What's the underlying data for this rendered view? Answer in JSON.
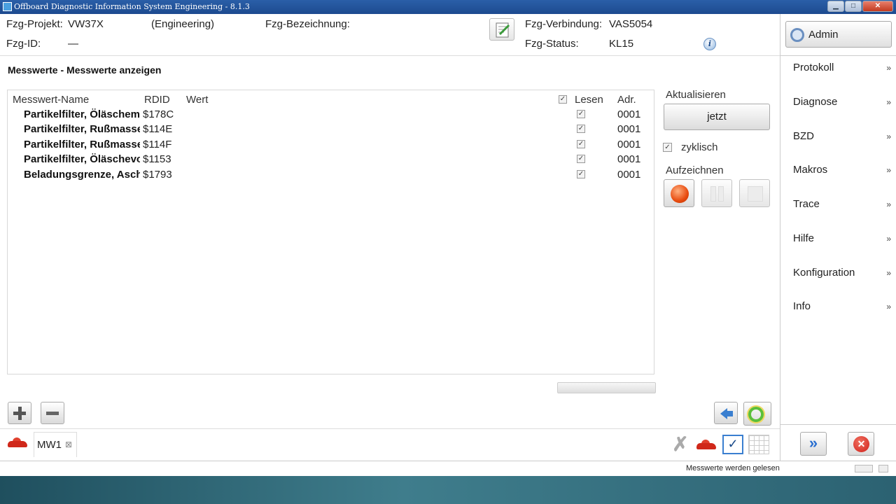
{
  "window": {
    "title": "Offboard Diagnostic Information System Engineering - 8.1.3",
    "minimize": "▁",
    "maximize": "□",
    "close": "✕"
  },
  "header": {
    "projekt_label": "Fzg-Projekt:",
    "projekt_value": "VW37X",
    "projekt_mode": "(Engineering)",
    "bezeichnung_label": "Fzg-Bezeichnung:",
    "id_label": "Fzg-ID:",
    "id_value": "—",
    "verbindung_label": "Fzg-Verbindung:",
    "verbindung_value": "VAS5054",
    "status_label": "Fzg-Status:",
    "status_value": "KL15",
    "info_glyph": "i"
  },
  "content": {
    "title": "Messwerte - Messwerte anzeigen"
  },
  "table": {
    "columns": {
      "name": "Messwert-Name",
      "rdid": "RDID",
      "wert": "Wert",
      "lesen": "Lesen",
      "adr": "Adr."
    },
    "header_checkbox": "✓",
    "rows": [
      {
        "name": "Partikelfilter, Öläschemasse",
        "rdid": "$178C",
        "lesen": "✓",
        "adr": "0001"
      },
      {
        "name": "Partikelfilter, Rußmasse berechnet",
        "rdid": "$114E",
        "lesen": "✓",
        "adr": "0001"
      },
      {
        "name": "Partikelfilter, Rußmasse gemessen",
        "rdid": "$114F",
        "lesen": "✓",
        "adr": "0001"
      },
      {
        "name": "Partikelfilter, Öläschevolumen",
        "rdid": "$1153",
        "lesen": "✓",
        "adr": "0001"
      },
      {
        "name": "Beladungsgrenze, Asche",
        "rdid": "$1793",
        "lesen": "✓",
        "adr": "0001"
      }
    ]
  },
  "controls": {
    "aktualisieren_label": "Aktualisieren",
    "jetzt_label": "jetzt",
    "zyklisch_label": "zyklisch",
    "zyklisch_checked": "✓",
    "aufzeichnen_label": "Aufzeichnen"
  },
  "tabs": [
    {
      "label": "MW1",
      "close": "⊠"
    }
  ],
  "toolbar": {
    "check_glyph": "✓",
    "x_glyph": "✗"
  },
  "status": {
    "text": "Messwerte werden gelesen"
  },
  "sidebar": {
    "admin_label": "Admin",
    "chevron": "»",
    "items": [
      "Protokoll",
      "Diagnose",
      "BZD",
      "Makros",
      "Trace",
      "Hilfe",
      "Konfiguration",
      "Info"
    ],
    "forward_glyph": "»",
    "cancel_glyph": "✕"
  }
}
